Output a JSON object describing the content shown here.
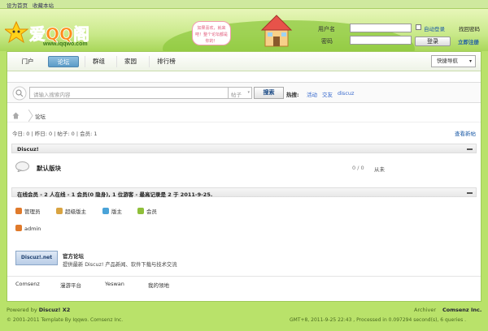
{
  "topbar": {
    "set_home": "设为首页",
    "bookmark": "收藏本站"
  },
  "header": {
    "logo_text": "爱QQ阁",
    "logo_domain": "www.iqqwo.com",
    "bubble_text": "如果喜欢，就来吧！整个论坛都是你的！",
    "username_label": "用户名",
    "password_label": "密码",
    "remember_label": "自动登录",
    "forgot_label": "找回密码",
    "login_button": "登录",
    "register_label": "立即注册"
  },
  "nav": {
    "items": [
      {
        "label": "门户"
      },
      {
        "label": "论坛"
      },
      {
        "label": "群组"
      },
      {
        "label": "家园"
      },
      {
        "label": "排行榜"
      }
    ],
    "quick_nav": "快捷导航"
  },
  "search": {
    "placeholder": "请输入搜索内容",
    "type": "帖子",
    "button": "搜索",
    "hot_label": "热搜:",
    "hot_links": [
      "活动",
      "交友",
      "discuz"
    ]
  },
  "breadcrumb": {
    "current": "论坛"
  },
  "stats": {
    "summary": "今日: 0 | 昨日: 0 | 帖子: 0 | 会员: 1",
    "view_new": "查看新帖"
  },
  "section1": {
    "title": "Discuz!"
  },
  "forum": {
    "name": "默认版块",
    "counts": "0 / 0",
    "last_post": "从未"
  },
  "online": {
    "title": "在线会员 - 2 人在线 - 1 会员(0 隐身), 1 位游客 - 最高记录是 2 于 2011-9-25.",
    "legend": [
      {
        "label": "管理员",
        "color": "#e07a2b"
      },
      {
        "label": "超级版主",
        "color": "#d9a441"
      },
      {
        "label": "版主",
        "color": "#4aa3d8"
      },
      {
        "label": "会员",
        "color": "#8fbf3a"
      }
    ],
    "member": "admin"
  },
  "official": {
    "banner": "Discuz!.net",
    "title": "官方论坛",
    "desc": "提供最新 Discuz! 产品新闻、软件下载与技术交流"
  },
  "friend_links": [
    "Comsenz",
    "漫游平台",
    "Yeswan",
    "我的领地"
  ],
  "footer": {
    "powered_prefix": "Powered by",
    "powered_name": "Discuz! X2",
    "copyright": "© 2001-2011 Template By Iqqwo. Comsenz Inc.",
    "archiver": "Archiver",
    "company": "Comsenz Inc.",
    "debug": "GMT+8, 2011-9-25 22:43 , Processed in 0.097294 second(s), 6 queries ."
  }
}
